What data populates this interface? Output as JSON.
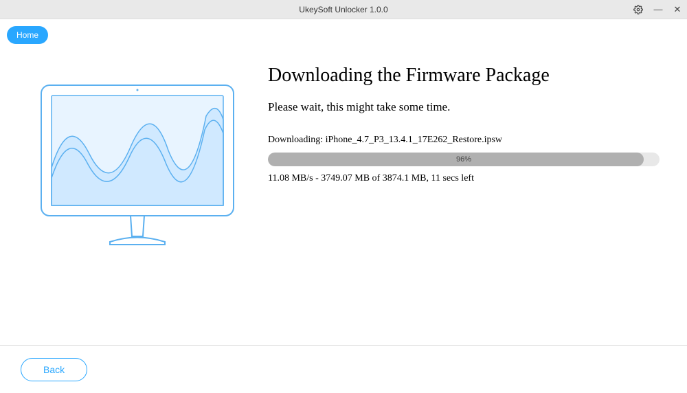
{
  "titlebar": {
    "title": "UkeySoft Unlocker 1.0.0"
  },
  "tabs": {
    "home": "Home"
  },
  "content": {
    "title": "Downloading the Firmware Package",
    "subtitle": "Please wait, this might take some time.",
    "download_label": "Downloading: iPhone_4.7_P3_13.4.1_17E262_Restore.ipsw",
    "progress_percent": "96%",
    "progress_width": "96%",
    "stats": "11.08 MB/s - 3749.07 MB of 3874.1 MB, 11 secs left"
  },
  "footer": {
    "back": "Back"
  }
}
